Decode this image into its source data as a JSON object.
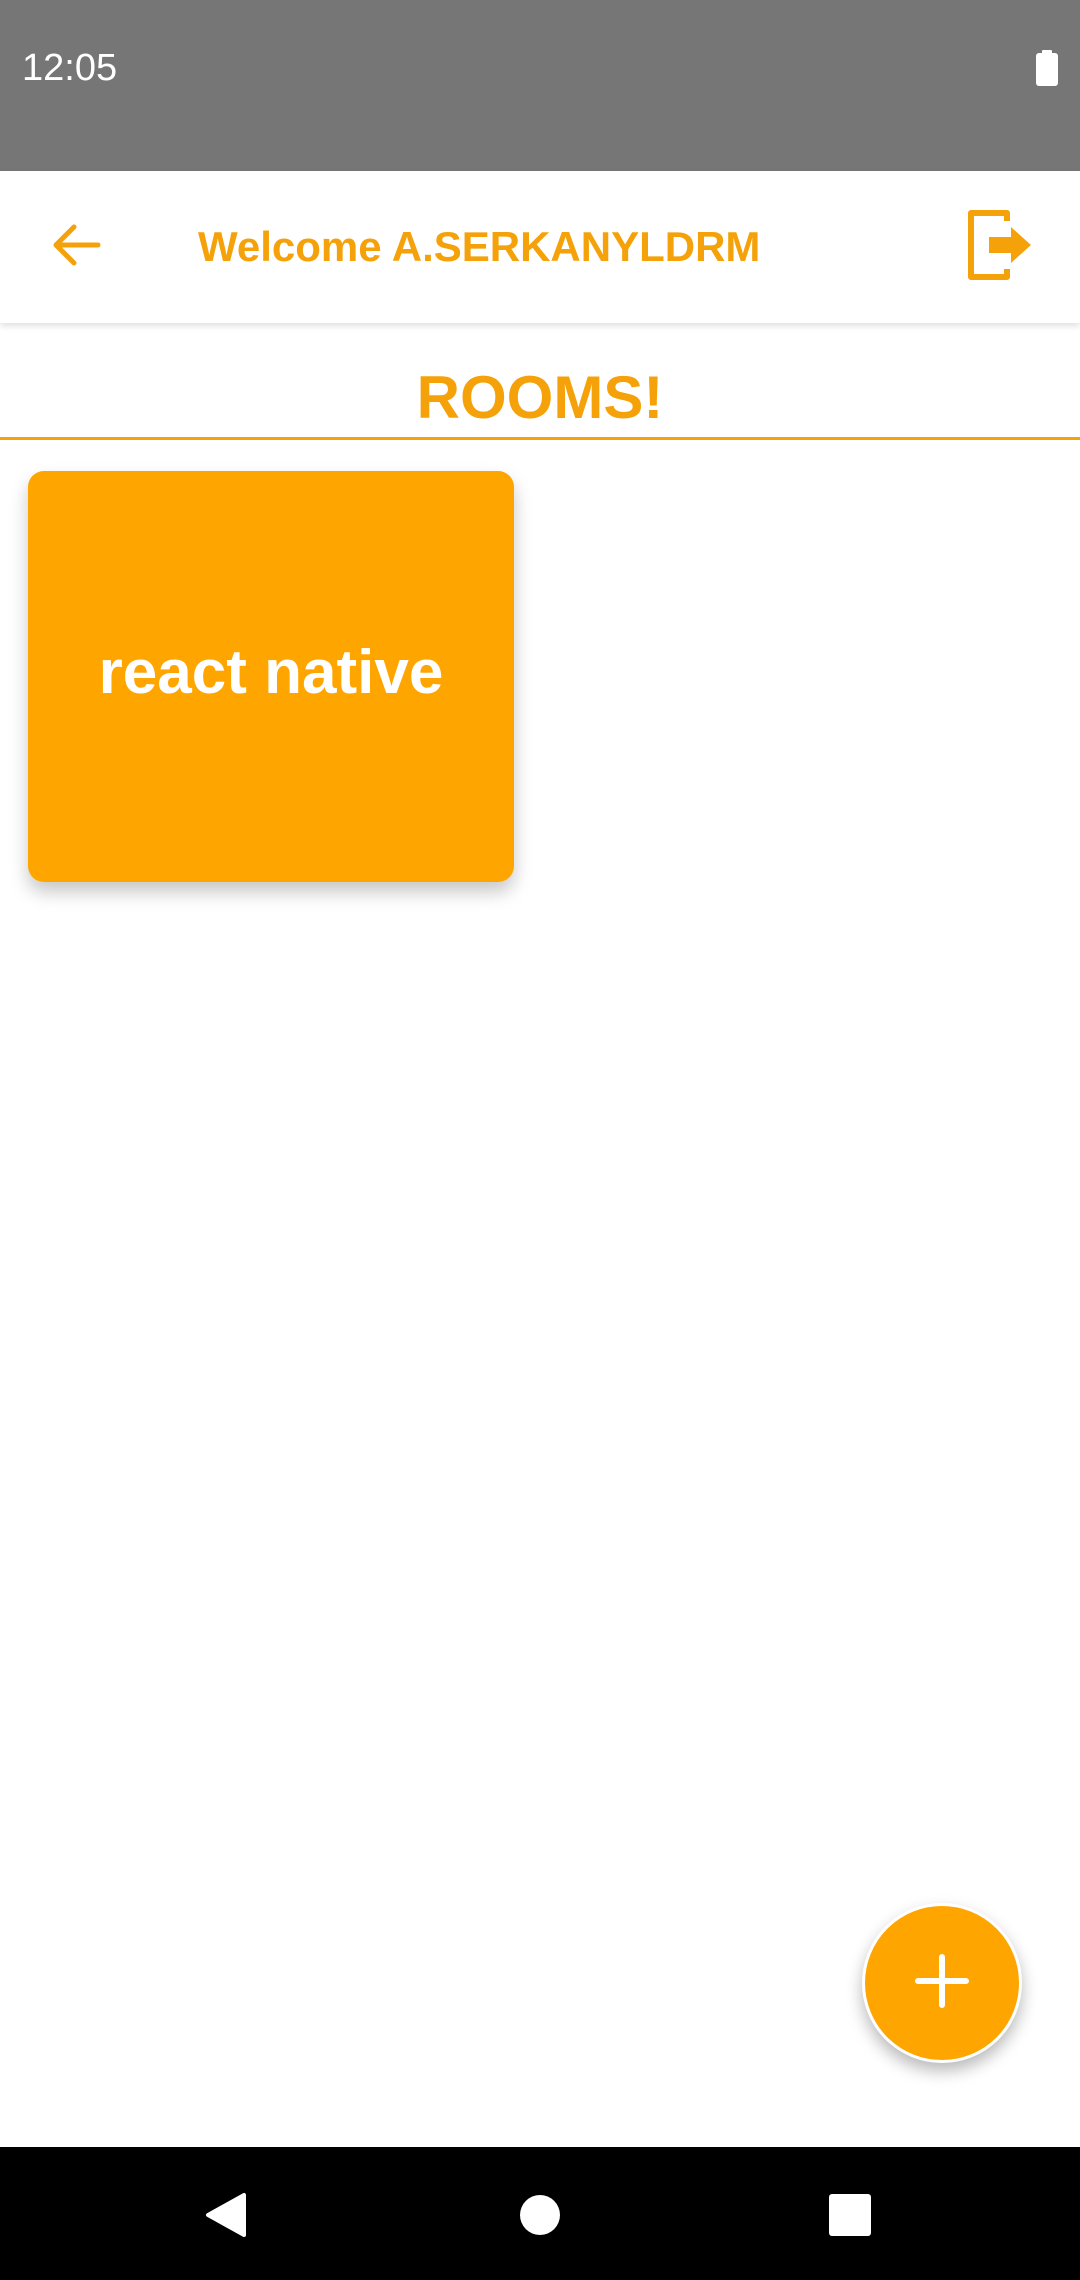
{
  "status_bar": {
    "time": "12:05",
    "battery_icon": "battery-full-icon"
  },
  "header": {
    "back_icon": "arrow-left-icon",
    "title": "Welcome A.SERKANYLDRM",
    "logout_icon": "logout-icon"
  },
  "rooms": {
    "heading": "ROOMS!",
    "items": [
      {
        "label": "react native"
      }
    ]
  },
  "fab": {
    "icon": "plus-icon"
  },
  "nav_bar": {
    "back_icon": "nav-back-icon",
    "home_icon": "nav-home-icon",
    "recents_icon": "nav-recents-icon"
  },
  "colors": {
    "accent": "#f5a20a",
    "card": "#ffa500",
    "status_bar": "#767676",
    "nav_bar": "#000000"
  }
}
